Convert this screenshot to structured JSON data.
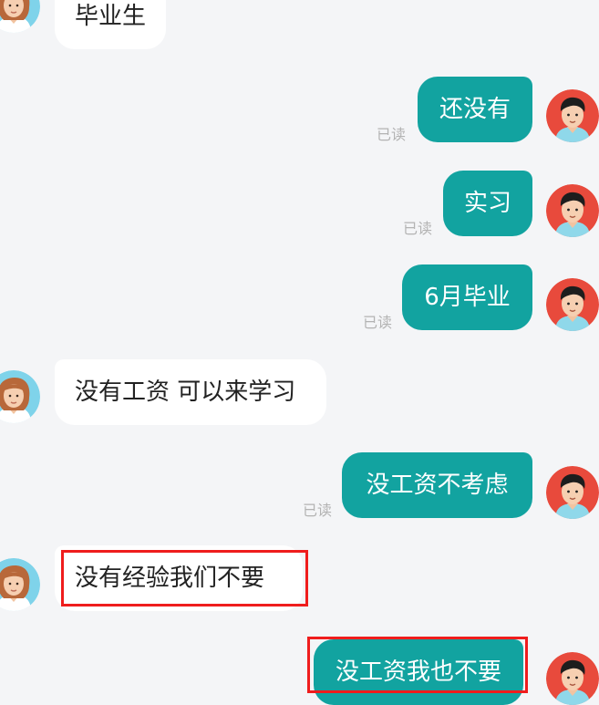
{
  "messages": [
    {
      "side": "in",
      "text": "毕业生"
    },
    {
      "side": "out",
      "text": "还没有",
      "status": "已读"
    },
    {
      "side": "out",
      "text": "实习",
      "status": "已读"
    },
    {
      "side": "out",
      "text": "6月毕业",
      "status": "已读"
    },
    {
      "side": "in",
      "text": "没有工资 可以来学习"
    },
    {
      "side": "out",
      "text": "没工资不考虑",
      "status": "已读"
    },
    {
      "side": "in",
      "text": "没有经验我们不要",
      "highlighted": true
    },
    {
      "side": "out",
      "text": "没工资我也不要",
      "highlighted": true
    }
  ],
  "avatars": {
    "other": "woman-avatar-icon",
    "self": "man-avatar-icon"
  },
  "colors": {
    "background": "#f4f5f7",
    "incoming_bubble": "#ffffff",
    "outgoing_bubble": "#12a3a0",
    "highlight_border": "#ef1d1d",
    "read_status": "#b3b3b3"
  }
}
